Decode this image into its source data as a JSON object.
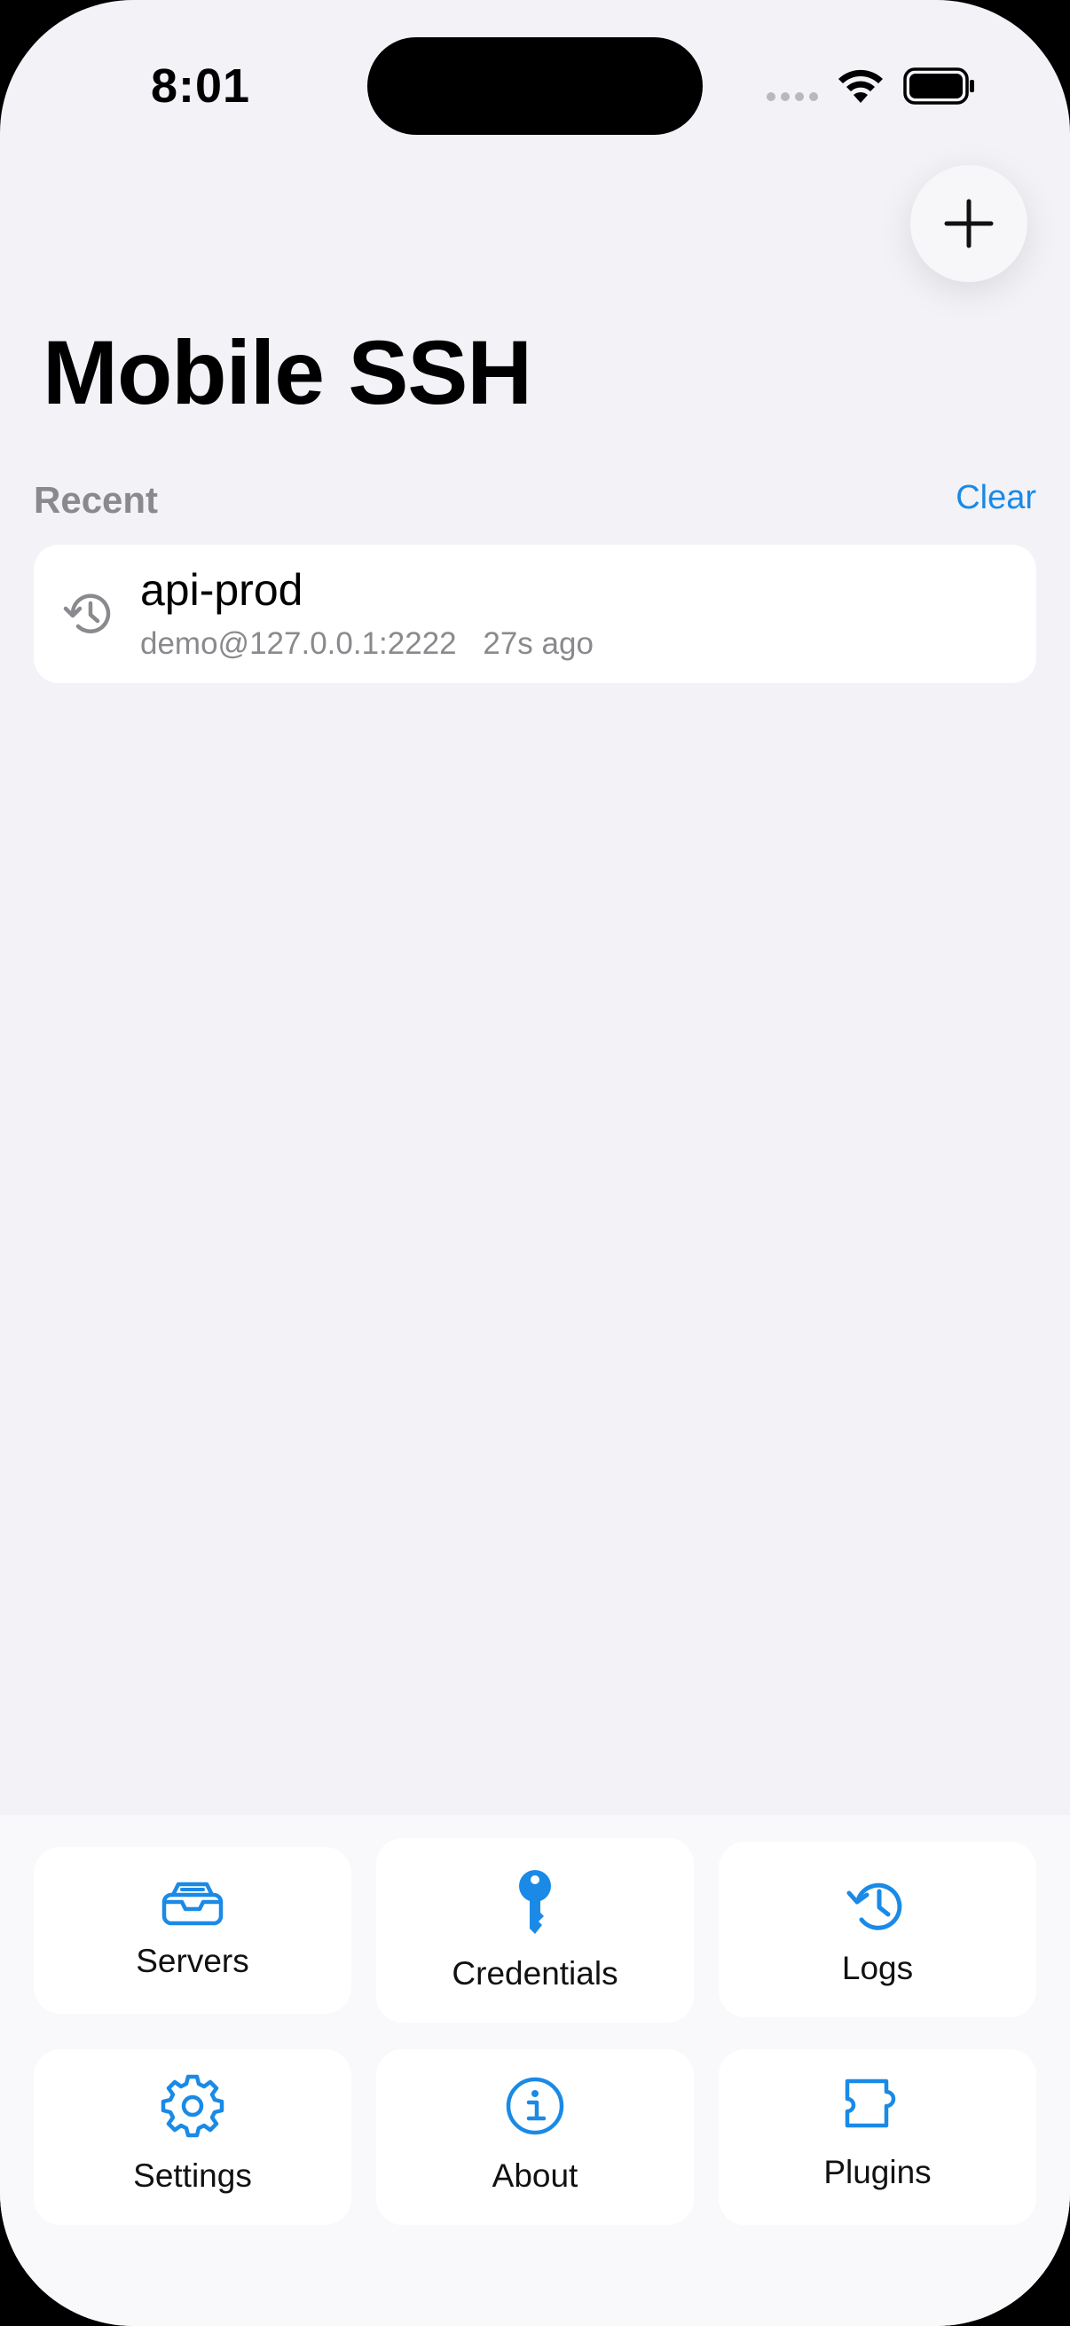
{
  "status_bar": {
    "time": "8:01"
  },
  "header": {
    "title": "Mobile SSH",
    "add_icon": "plus-icon"
  },
  "recent": {
    "section_label": "Recent",
    "clear_label": "Clear",
    "items": [
      {
        "name": "api-prod",
        "address": "demo@127.0.0.1:2222",
        "time_ago": "27s ago",
        "icon": "history-icon"
      }
    ]
  },
  "nav": {
    "tiles": [
      {
        "label": "Servers",
        "icon": "inbox-tray-icon"
      },
      {
        "label": "Credentials",
        "icon": "key-icon"
      },
      {
        "label": "Logs",
        "icon": "clock-history-icon"
      },
      {
        "label": "Settings",
        "icon": "gear-icon"
      },
      {
        "label": "About",
        "icon": "info-icon"
      },
      {
        "label": "Plugins",
        "icon": "puzzle-icon"
      }
    ]
  },
  "colors": {
    "accent": "#1a8ae6",
    "background": "#f2f2f7",
    "secondary_text": "#8a8a8e"
  }
}
